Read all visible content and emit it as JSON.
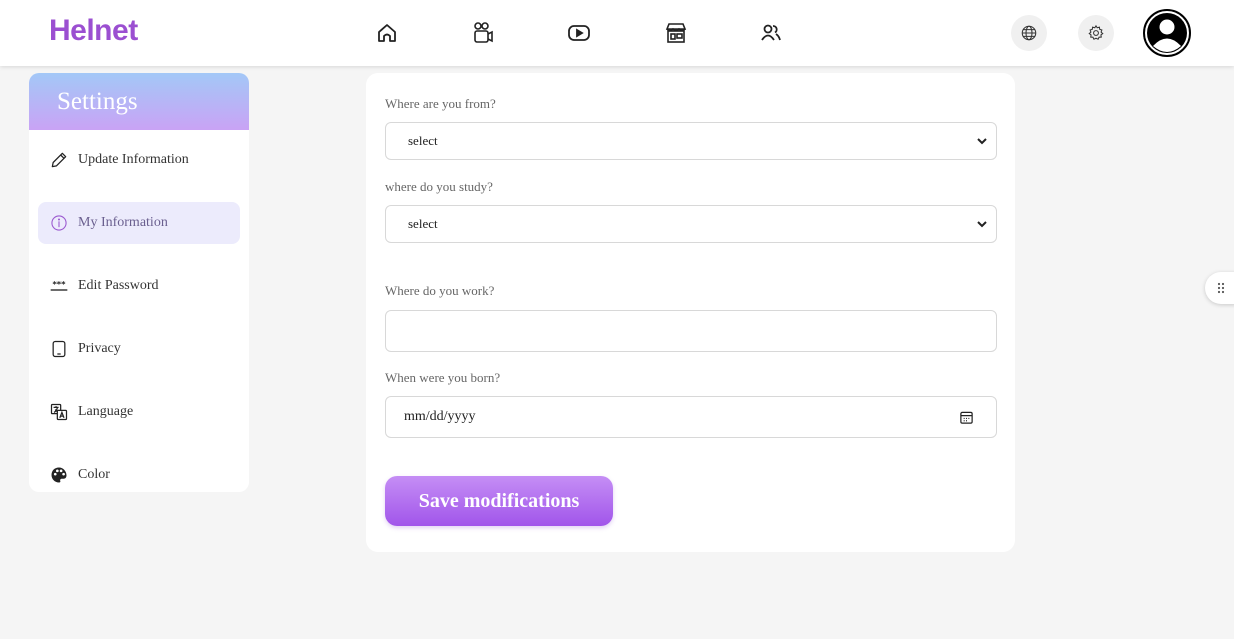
{
  "app": {
    "logo_text": "Helnet",
    "brand_color": "#9b4fd1"
  },
  "topnav": {
    "icons": [
      "home-icon",
      "video-call-icon",
      "play-video-icon",
      "store-icon",
      "friends-icon"
    ],
    "right": [
      "globe-icon",
      "gear-icon",
      "user-avatar-icon"
    ]
  },
  "sidebar": {
    "title": "Settings",
    "items": [
      {
        "label": "Update Information",
        "icon": "pencil-icon",
        "active": false
      },
      {
        "label": "My Information",
        "icon": "info-circle-icon",
        "active": true
      },
      {
        "label": "Edit Password",
        "icon": "password-dots-icon",
        "active": false
      },
      {
        "label": "Privacy",
        "icon": "phone-icon",
        "active": false
      },
      {
        "label": "Language",
        "icon": "translate-icon",
        "active": false
      },
      {
        "label": "Color",
        "icon": "palette-icon",
        "active": false
      }
    ]
  },
  "form": {
    "country": {
      "label": "Where are you from?",
      "value": "select"
    },
    "study": {
      "label": "where do you study?",
      "value": "select"
    },
    "work": {
      "label": "Where do you work?",
      "value": ""
    },
    "birth": {
      "label": "When were you born?",
      "placeholder": "mm/dd/yyyy"
    },
    "save_label": "Save modifications"
  }
}
